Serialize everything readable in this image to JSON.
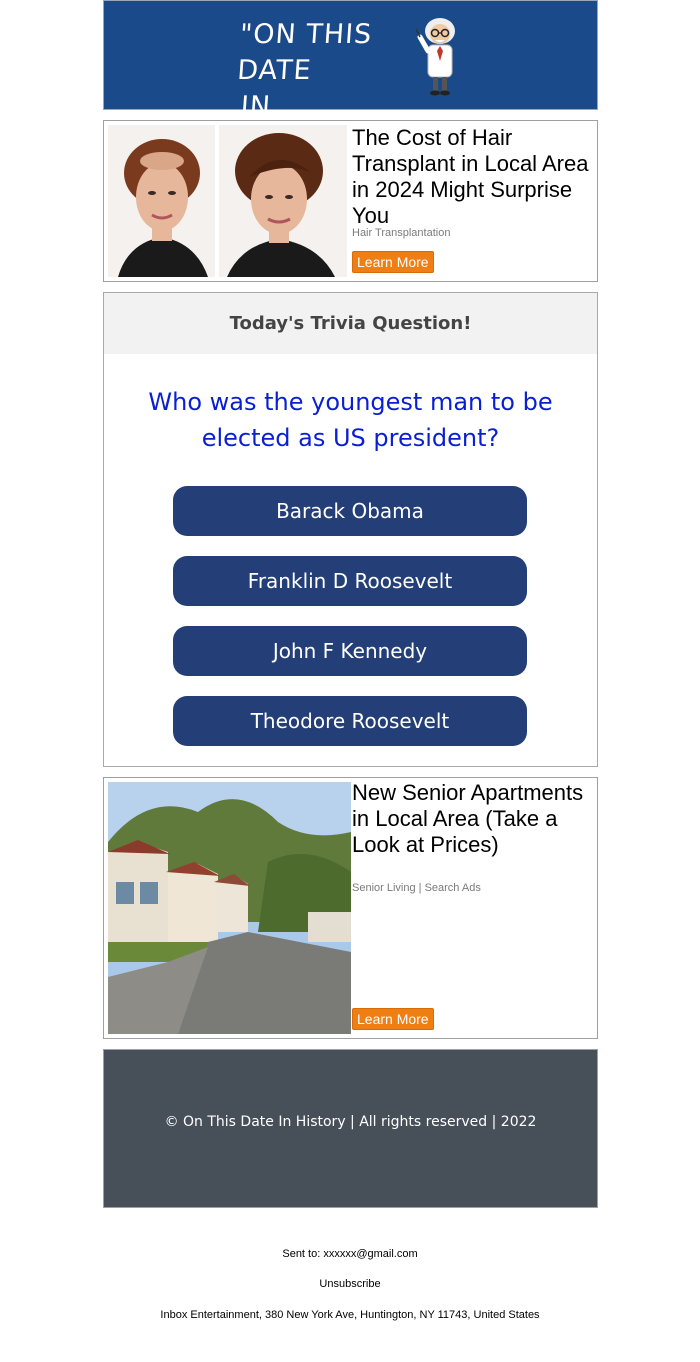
{
  "banner": {
    "title_line1": "\"ON THIS DATE",
    "title_line2": "IN HISTORY...\"",
    "colors": {
      "background": "#1b4a8a"
    }
  },
  "ad_top": {
    "headline": "The Cost of Hair Transplant in Local Area in 2024 Might Surprise You",
    "sponsor": "Hair Transplantation",
    "cta": "Learn More"
  },
  "trivia": {
    "heading": "Today's Trivia Question!",
    "question": "Who was the youngest man to be elected as US president?",
    "answers": [
      {
        "label": "Barack Obama"
      },
      {
        "label": "Franklin D Roosevelt"
      },
      {
        "label": "John F Kennedy"
      },
      {
        "label": "Theodore Roosevelt"
      }
    ],
    "colors": {
      "question": "#0a1fd1",
      "answer_button": "#243f78"
    }
  },
  "ad_bottom": {
    "headline": "New Senior Apartments in Local Area (Take a Look at Prices)",
    "sponsor": "Senior Living | Search Ads",
    "cta": "Learn More"
  },
  "footer": {
    "copyright": "© On This Date In History | All rights reserved | 2022"
  },
  "meta_footer": {
    "sent_to": "Sent to: xxxxxx@gmail.com",
    "unsubscribe": "Unsubscribe",
    "address": "Inbox Entertainment, 380 New York Ave, Huntington, NY 11743, United States"
  }
}
